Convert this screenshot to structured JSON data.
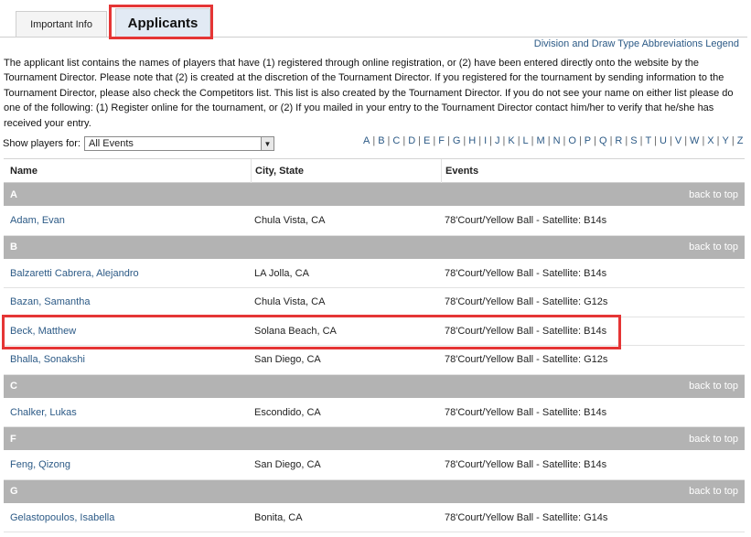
{
  "tabs": [
    {
      "label": "Important Info"
    },
    {
      "label": "Applicants"
    }
  ],
  "legend_link": "Division and Draw Type Abbreviations Legend",
  "intro_text": "The applicant list contains the names of players that have (1) registered through online registration, or (2) have been entered directly onto the website by the Tournament Director. Please note that (2) is created at the discretion of the Tournament Director. If you registered for the tournament by sending information to the Tournament Director, please also check the Competitors list. This list is also created by the Tournament Director. If you do not see your name on either list please do one of the following: (1) Register online for the tournament, or (2) If you mailed in your entry to the Tournament Director contact him/her to verify that he/she has received your entry.",
  "filter": {
    "label": "Show players for:",
    "selected": "All Events"
  },
  "alphabet": [
    "A",
    "B",
    "C",
    "D",
    "E",
    "F",
    "G",
    "H",
    "I",
    "J",
    "K",
    "L",
    "M",
    "N",
    "O",
    "P",
    "Q",
    "R",
    "S",
    "T",
    "U",
    "V",
    "W",
    "X",
    "Y",
    "Z"
  ],
  "table": {
    "headers": {
      "name": "Name",
      "city": "City, State",
      "events": "Events"
    },
    "back_to_top": "back to top",
    "groups": [
      {
        "letter": "A",
        "rows": [
          {
            "name": "Adam, Evan",
            "city": "Chula Vista, CA",
            "events": "78'Court/Yellow Ball - Satellite: B14s"
          }
        ]
      },
      {
        "letter": "B",
        "rows": [
          {
            "name": "Balzaretti Cabrera, Alejandro",
            "city": "LA Jolla, CA",
            "events": "78'Court/Yellow Ball - Satellite: B14s"
          },
          {
            "name": "Bazan, Samantha",
            "city": "Chula Vista, CA",
            "events": "78'Court/Yellow Ball - Satellite: G12s"
          },
          {
            "name": "Beck, Matthew",
            "city": "Solana Beach, CA",
            "events": "78'Court/Yellow Ball - Satellite: B14s"
          },
          {
            "name": "Bhalla, Sonakshi",
            "city": "San Diego, CA",
            "events": "78'Court/Yellow Ball - Satellite: G12s"
          }
        ]
      },
      {
        "letter": "C",
        "rows": [
          {
            "name": "Chalker, Lukas",
            "city": "Escondido, CA",
            "events": "78'Court/Yellow Ball - Satellite: B14s"
          }
        ]
      },
      {
        "letter": "F",
        "rows": [
          {
            "name": "Feng, Qizong",
            "city": "San Diego, CA",
            "events": "78'Court/Yellow Ball - Satellite: B14s"
          }
        ]
      },
      {
        "letter": "G",
        "rows": [
          {
            "name": "Gelastopoulos, Isabella",
            "city": "Bonita, CA",
            "events": "78'Court/Yellow Ball - Satellite: G14s"
          }
        ]
      }
    ]
  },
  "colors": {
    "link": "#2c5a86",
    "highlight": "#e53535",
    "group_bar": "#b3b3b3"
  }
}
